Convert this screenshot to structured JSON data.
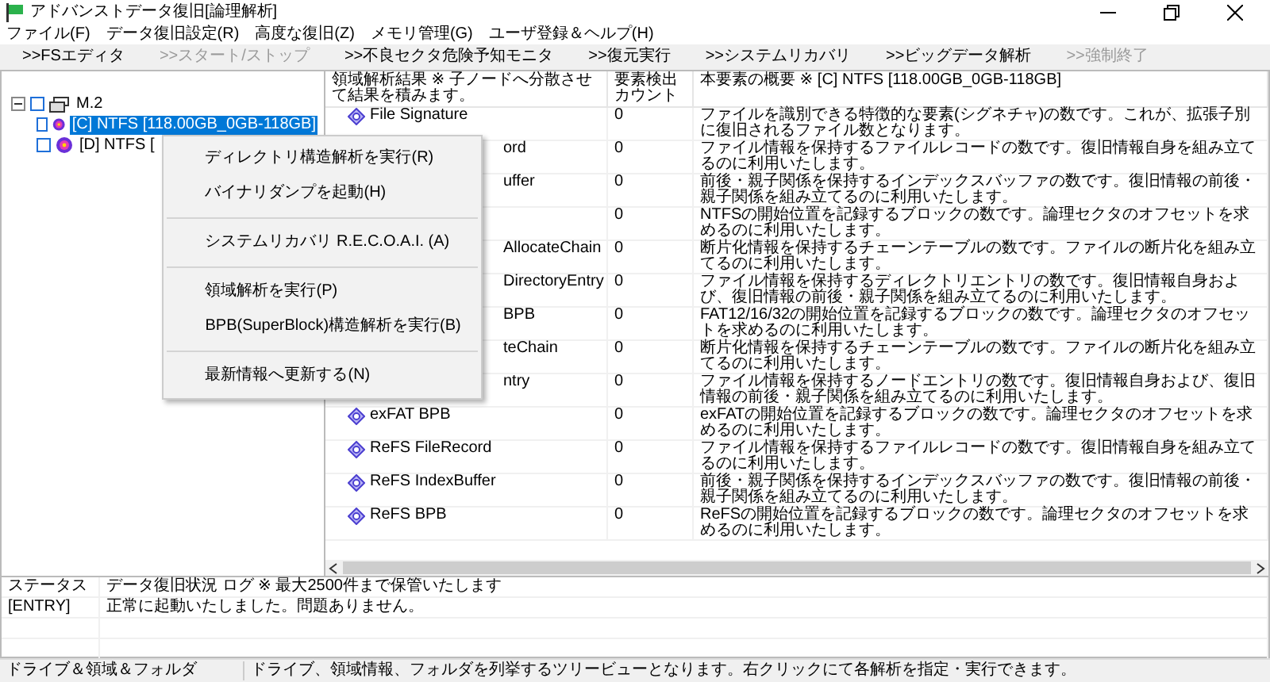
{
  "window": {
    "title": "アドバンストデータ復旧[論理解析]"
  },
  "menu": [
    "ファイル(F)",
    "データ復旧設定(R)",
    "高度な復旧(Z)",
    "メモリ管理(G)",
    "ユーザ登録＆ヘルプ(H)"
  ],
  "toolbar": [
    {
      "label": ">>FSエディタ",
      "disabled": false
    },
    {
      "label": ">>スタート/ストップ",
      "disabled": true
    },
    {
      "label": ">>不良セクタ危険予知モニタ",
      "disabled": false
    },
    {
      "label": ">>復元実行",
      "disabled": false
    },
    {
      "label": ">>システムリカバリ",
      "disabled": false
    },
    {
      "label": ">>ビッグデータ解析",
      "disabled": false
    },
    {
      "label": ">>強制終了",
      "disabled": true
    }
  ],
  "tree": {
    "items": [
      {
        "label": "M.2",
        "expanded": true,
        "checked": false,
        "selected": false,
        "children": [
          {
            "label": "[C] NTFS [118.00GB_0GB-118GB]",
            "checked": false,
            "selected": true
          },
          {
            "label": "[D] NTFS [",
            "checked": false,
            "selected": false
          }
        ]
      }
    ]
  },
  "context_menu": {
    "items": [
      {
        "kind": "item",
        "label": "ディレクトリ構造解析を実行(R)"
      },
      {
        "kind": "item",
        "label": "バイナリダンプを起動(H)"
      },
      {
        "kind": "separator"
      },
      {
        "kind": "item",
        "label": "システムリカバリ R.E.C.O.A.I. (A)"
      },
      {
        "kind": "separator"
      },
      {
        "kind": "item",
        "label": "領域解析を実行(P)"
      },
      {
        "kind": "item",
        "label": "BPB(SuperBlock)構造解析を実行(B)"
      },
      {
        "kind": "separator"
      },
      {
        "kind": "item",
        "label": "最新情報へ更新する(N)"
      }
    ]
  },
  "table": {
    "columns": [
      "領域解析結果 ※ 子ノードへ分散させて結果を積みます。",
      "要素検出カウント",
      "本要素の概要 ※ [C] NTFS [118.00GB_0GB-118GB]"
    ],
    "rows": [
      {
        "name": "File Signature",
        "covered": false,
        "count": "0",
        "description": "ファイルを識別できる特徴的な要素(シグネチャ)の数です。これが、拡張子別に復旧されるファイル数となります。"
      },
      {
        "name": "ord",
        "covered": true,
        "count": "0",
        "description": "ファイル情報を保持するファイルレコードの数です。復旧情報自身を組み立てるのに利用いたします。"
      },
      {
        "name": "uffer",
        "covered": true,
        "count": "0",
        "description": "前後・親子関係を保持するインデックスバッファの数です。復旧情報の前後・親子関係を組み立てるのに利用いたします。"
      },
      {
        "covered": true,
        "count": "0",
        "description": "NTFSの開始位置を記録するブロックの数です。論理セクタのオフセットを求めるのに利用いたします。"
      },
      {
        "name": "AllocateChain",
        "covered": true,
        "count": "0",
        "description": "断片化情報を保持するチェーンテーブルの数です。ファイルの断片化を組み立てるのに利用いたします。"
      },
      {
        "name": "DirectoryEntry",
        "covered": true,
        "count": "0",
        "description": "ファイル情報を保持するディレクトリエントリの数です。復旧情報自身および、復旧情報の前後・親子関係を組み立てるのに利用いたします。"
      },
      {
        "name": "BPB",
        "covered": true,
        "count": "0",
        "description": "FAT12/16/32の開始位置を記録するブロックの数です。論理セクタのオフセットを求めるのに利用いたします。"
      },
      {
        "name": "teChain",
        "covered": true,
        "count": "0",
        "description": "断片化情報を保持するチェーンテーブルの数です。ファイルの断片化を組み立てるのに利用いたします。"
      },
      {
        "name": "ntry",
        "covered": true,
        "count": "0",
        "description": "ファイル情報を保持するノードエントリの数です。復旧情報自身および、復旧情報の前後・親子関係を組み立てるのに利用いたします。"
      },
      {
        "name": "exFAT BPB",
        "covered": false,
        "count": "0",
        "description": "exFATの開始位置を記録するブロックの数です。論理セクタのオフセットを求めるのに利用いたします。"
      },
      {
        "name": "ReFS FileRecord",
        "covered": false,
        "count": "0",
        "description": "ファイル情報を保持するファイルレコードの数です。復旧情報自身を組み立てるのに利用いたします。"
      },
      {
        "name": "ReFS IndexBuffer",
        "covered": false,
        "count": "0",
        "description": "前後・親子関係を保持するインデックスバッファの数です。復旧情報の前後・親子関係を組み立てるのに利用いたします。"
      },
      {
        "name": "ReFS BPB",
        "covered": false,
        "count": "0",
        "description": "ReFSの開始位置を記録するブロックの数です。論理セクタのオフセットを求めるのに利用いたします。"
      }
    ]
  },
  "log": {
    "columns": [
      "ステータス",
      "データ復旧状況 ログ ※ 最大2500件まで保管いたします"
    ],
    "rows": [
      {
        "status": "[ENTRY]",
        "message": "正常に起動いたしました。問題ありません。"
      }
    ]
  },
  "status_bar": [
    "ドライブ＆領域＆フォルダ",
    "ドライブ、領域情報、フォルダを列挙するツリービューとなります。右クリックにて各解析を指定・実行できます。"
  ]
}
